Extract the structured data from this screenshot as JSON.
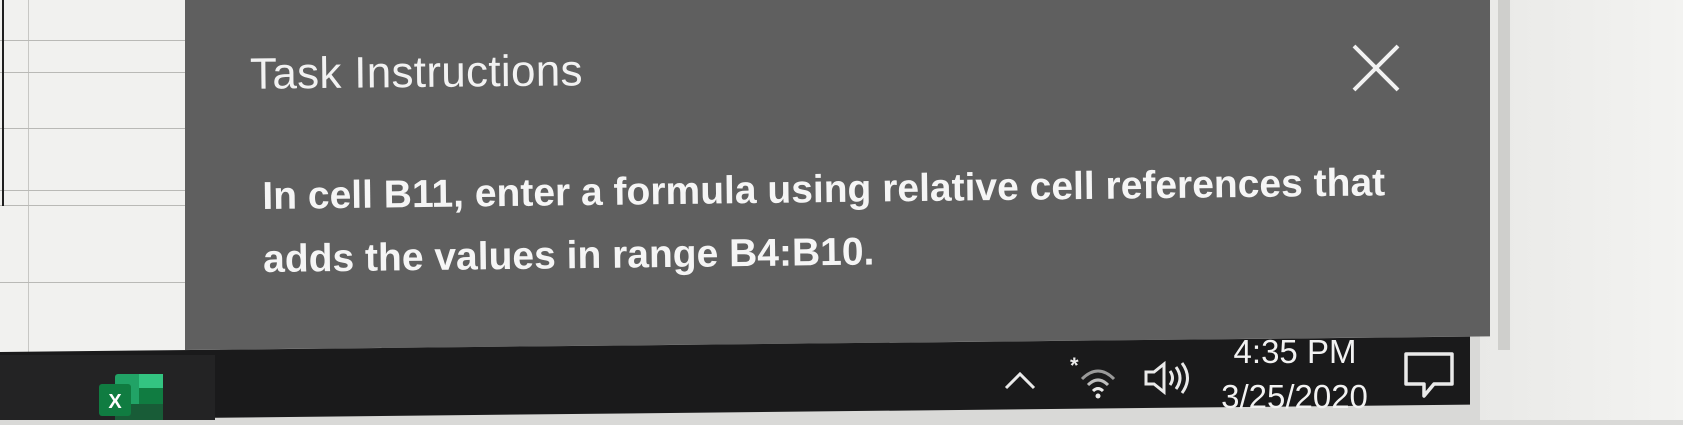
{
  "dialog": {
    "title": "Task Instructions",
    "instruction": "In cell B11, enter a formula using relative cell references that adds the values in range B4:B10.",
    "close_icon": "close-icon"
  },
  "taskbar": {
    "pinned_app_icon": "excel-icon",
    "pinned_app_label": "X",
    "tray_icons": [
      "chevron-up-icon",
      "wifi-icon",
      "speaker-icon"
    ],
    "time": "4:35 PM",
    "date": "3/25/2020",
    "notification_icon": "notification-icon"
  },
  "colors": {
    "panel": "#5f5f5f",
    "taskbar": "#1a1a1b",
    "excel_green": "#1f8a4c"
  }
}
